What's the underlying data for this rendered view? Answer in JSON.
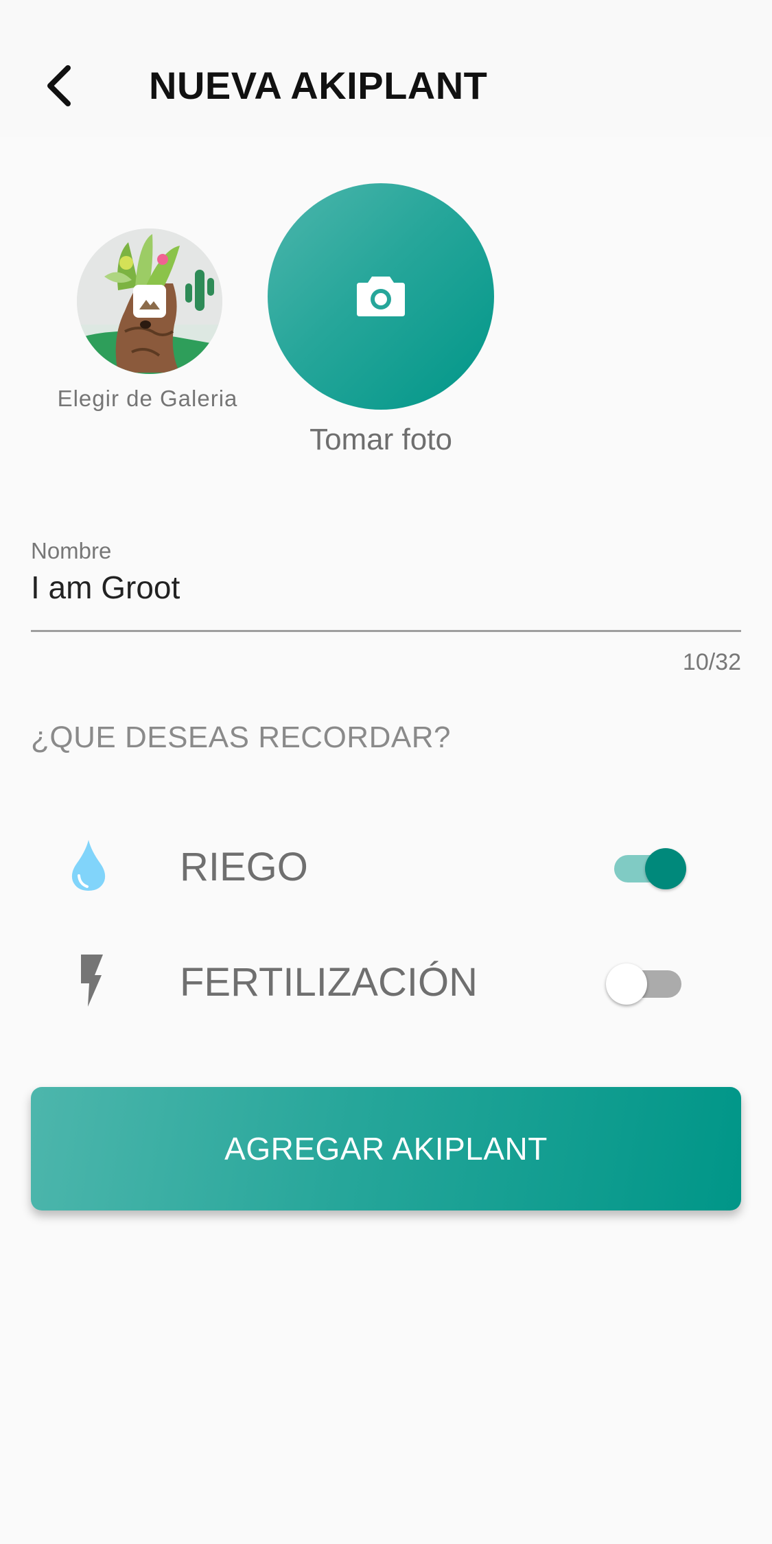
{
  "header": {
    "title": "NUEVA AKIPLANT",
    "back_icon": "chevron-left-icon"
  },
  "photo": {
    "gallery_label": "Elegir de Galeria",
    "camera_label": "Tomar foto",
    "camera_icon": "camera-icon",
    "gallery_icon": "image-icon"
  },
  "name_field": {
    "label": "Nombre",
    "value": "I am Groot",
    "counter": "10/32"
  },
  "reminders": {
    "title": "¿QUE DESEAS RECORDAR?",
    "items": [
      {
        "label": "RIEGO",
        "icon": "water-drop-icon",
        "enabled": true
      },
      {
        "label": "FERTILIZACIÓN",
        "icon": "lightning-icon",
        "enabled": false
      }
    ]
  },
  "submit": {
    "label": "AGREGAR AKIPLANT"
  },
  "colors": {
    "accent": "#009688",
    "accent_light": "#4DB6AC",
    "toggle_on_thumb": "#00897B",
    "toggle_on_track": "#80CBC4",
    "water_icon": "#81D4FA"
  }
}
